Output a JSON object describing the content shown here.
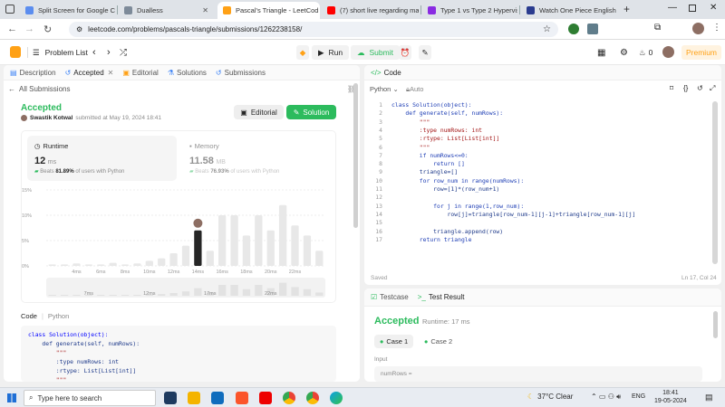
{
  "browser": {
    "tabs": [
      {
        "title": "Split Screen for Google Ch",
        "color": "#5b8def"
      },
      {
        "title": "Dualless",
        "color": "#7d8a99"
      },
      {
        "title": "Pascal's Triangle - LeetCod",
        "color": "#ffa116"
      },
      {
        "title": "(7) short live regarding ma",
        "color": "#ff0000"
      },
      {
        "title": "Type 1 vs Type 2 Hypervis",
        "color": "#8a2be2"
      },
      {
        "title": "Watch One Piece English S",
        "color": "#2a3b8f"
      }
    ],
    "url": "leetcode.com/problems/pascals-triangle/submissions/1262238158/"
  },
  "lc_header": {
    "problem_list": "Problem List",
    "run": "Run",
    "submit": "Submit",
    "streak": "0",
    "premium": "Premium"
  },
  "left": {
    "tabs": [
      "Description",
      "Accepted",
      "Editorial",
      "Solutions",
      "Submissions"
    ],
    "all_submissions": "All Submissions",
    "status": "Accepted",
    "user": "Swastik Kotwal",
    "submitted": "submitted at May 19, 2024 18:41",
    "editorial_btn": "Editorial",
    "solution_btn": "Solution",
    "runtime_label": "Runtime",
    "runtime_value": "12",
    "runtime_unit": "ms",
    "runtime_beats_pre": "Beats",
    "runtime_beats": "81.89%",
    "runtime_beats_post": "of users with Python",
    "memory_label": "Memory",
    "memory_value": "11.58",
    "memory_unit": "MB",
    "memory_beats_pre": "Beats",
    "memory_beats": "76.93%",
    "memory_beats_post": "of users with Python",
    "code_label": "Code",
    "lang_label": "Python",
    "code_lines": [
      "class Solution(object):",
      "    def generate(self, numRows):",
      "        \"\"\"",
      "        :type numRows: int",
      "        :rtype: List[List[int]]",
      "        \"\"\""
    ]
  },
  "chart_data": {
    "type": "bar",
    "y_ticks": [
      "15%",
      "10%",
      "5%",
      "0%"
    ],
    "x_ticks": [
      "4ms",
      "6ms",
      "8ms",
      "10ms",
      "12ms",
      "14ms",
      "16ms",
      "18ms",
      "20ms",
      "22ms"
    ],
    "mini_ticks": [
      "7ms",
      "12ms",
      "17ms",
      "22ms"
    ],
    "ylim": [
      0,
      15
    ],
    "values": [
      0.3,
      0.3,
      0.5,
      0.3,
      0.3,
      0.6,
      0.3,
      0.5,
      1,
      1.5,
      2.5,
      4,
      7,
      3,
      10,
      10,
      6,
      10,
      7,
      12,
      8,
      6,
      3
    ],
    "highlight_index": 12,
    "bar_color": "#e8e8e8",
    "highlight_color": "#262626"
  },
  "editor": {
    "tab": "Code",
    "lang": "Python",
    "mode": "Auto",
    "status": "Saved",
    "cursor": "Ln 17, Col 24",
    "lines": [
      "class Solution(object):",
      "    def generate(self, numRows):",
      "        \"\"\"",
      "        :type numRows: int",
      "        :rtype: List[List[int]]",
      "        \"\"\"",
      "        if numRows<=0:",
      "            return []",
      "        triangle=[]",
      "        for row_num in range(numRows):",
      "            row=[1]*(row_num+1)",
      "",
      "            for j in range(1,row_num):",
      "                row[j]=triangle[row_num-1][j-1]+triangle[row_num-1][j]",
      "",
      "            triangle.append(row)",
      "        return triangle"
    ],
    "line_numbers": [
      "1",
      "2",
      "3",
      "4",
      "5",
      "6",
      "7",
      "8",
      "9",
      "10",
      "11",
      "12",
      "13",
      "14",
      "15",
      "16",
      "17"
    ]
  },
  "testpanel": {
    "tab_testcase": "Testcase",
    "tab_result": "Test Result",
    "status": "Accepted",
    "runtime": "Runtime: 17 ms",
    "cases": [
      "Case 1",
      "Case 2"
    ],
    "input_label": "Input",
    "input_var": "numRows ="
  },
  "taskbar": {
    "search": "Type here to search",
    "weather": "37°C  Clear",
    "lang": "ENG",
    "time": "18:41",
    "date": "19-05-2024"
  }
}
